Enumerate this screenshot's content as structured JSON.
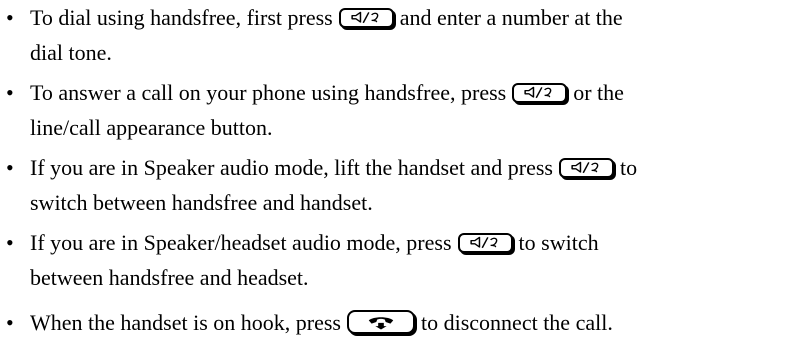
{
  "list": {
    "bullet": "•",
    "items": [
      {
        "before": "To dial using handsfree, first press",
        "after": "and enter a number at the",
        "cont": "dial tone.",
        "icon": "speaker-key-icon"
      },
      {
        "before": "To answer a call on your phone using handsfree, press",
        "after": "or the",
        "cont": "line/call appearance button.",
        "icon": "speaker-key-icon"
      },
      {
        "before": "If you are in Speaker audio mode, lift the handset and press",
        "after": "to",
        "cont": "switch between handsfree and handset.",
        "icon": "speaker-key-icon"
      },
      {
        "before": "If you are in Speaker/headset audio mode, press",
        "after": "to switch",
        "cont": "between handsfree and headset.",
        "icon": "speaker-key-icon"
      },
      {
        "before": "When the handset is on hook, press",
        "after": "to disconnect the call.",
        "icon": "release-key-icon"
      }
    ]
  }
}
